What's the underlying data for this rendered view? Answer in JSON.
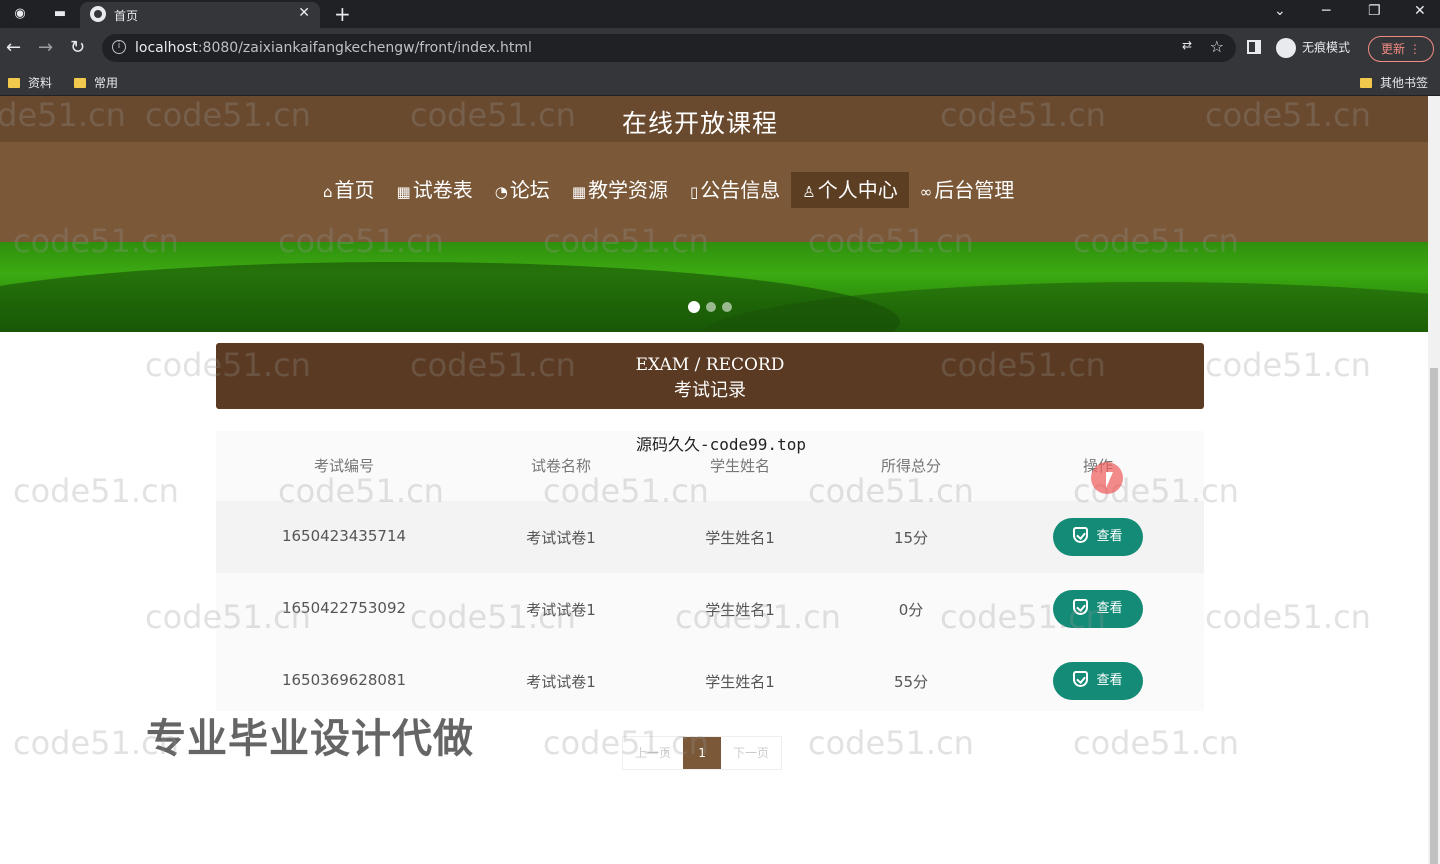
{
  "browser": {
    "tab_title": "首页",
    "url_host": "localhost",
    "url_rest": ":8080/zaixiankaifangkechengw/front/index.html",
    "profile_label": "无痕模式",
    "update_label": "更新",
    "bookmarks": [
      "资料",
      "常用"
    ],
    "other_bookmarks": "其他书签"
  },
  "site": {
    "brand": "在线开放课程",
    "nav": [
      {
        "icon": "⌂",
        "label": "首页"
      },
      {
        "icon": "▦",
        "label": "试卷表"
      },
      {
        "icon": "◔",
        "label": "论坛"
      },
      {
        "icon": "▦",
        "label": "教学资源"
      },
      {
        "icon": "▯",
        "label": "公告信息"
      },
      {
        "icon": "♙",
        "label": "个人中心"
      },
      {
        "icon": "∞",
        "label": "后台管理"
      }
    ],
    "active_nav": "个人中心"
  },
  "section": {
    "title_en": "EXAM / RECORD",
    "title_zh": "考试记录"
  },
  "table": {
    "headers": [
      "考试编号",
      "试卷名称",
      "学生姓名",
      "所得总分",
      "操作"
    ],
    "rows": [
      {
        "id": "1650423435714",
        "paper": "考试试卷1",
        "student": "学生姓名1",
        "score": "15分",
        "action": "查看"
      },
      {
        "id": "1650422753092",
        "paper": "考试试卷1",
        "student": "学生姓名1",
        "score": "0分",
        "action": "查看"
      },
      {
        "id": "1650369628081",
        "paper": "考试试卷1",
        "student": "学生姓名1",
        "score": "55分",
        "action": "查看"
      }
    ]
  },
  "pager": {
    "prev": "上一页",
    "current": "1",
    "next": "下一页"
  },
  "overlay": {
    "watermark_top": "源码久久-code99.top",
    "promo": "专业毕业设计代做",
    "watermark": "code51.cn"
  }
}
